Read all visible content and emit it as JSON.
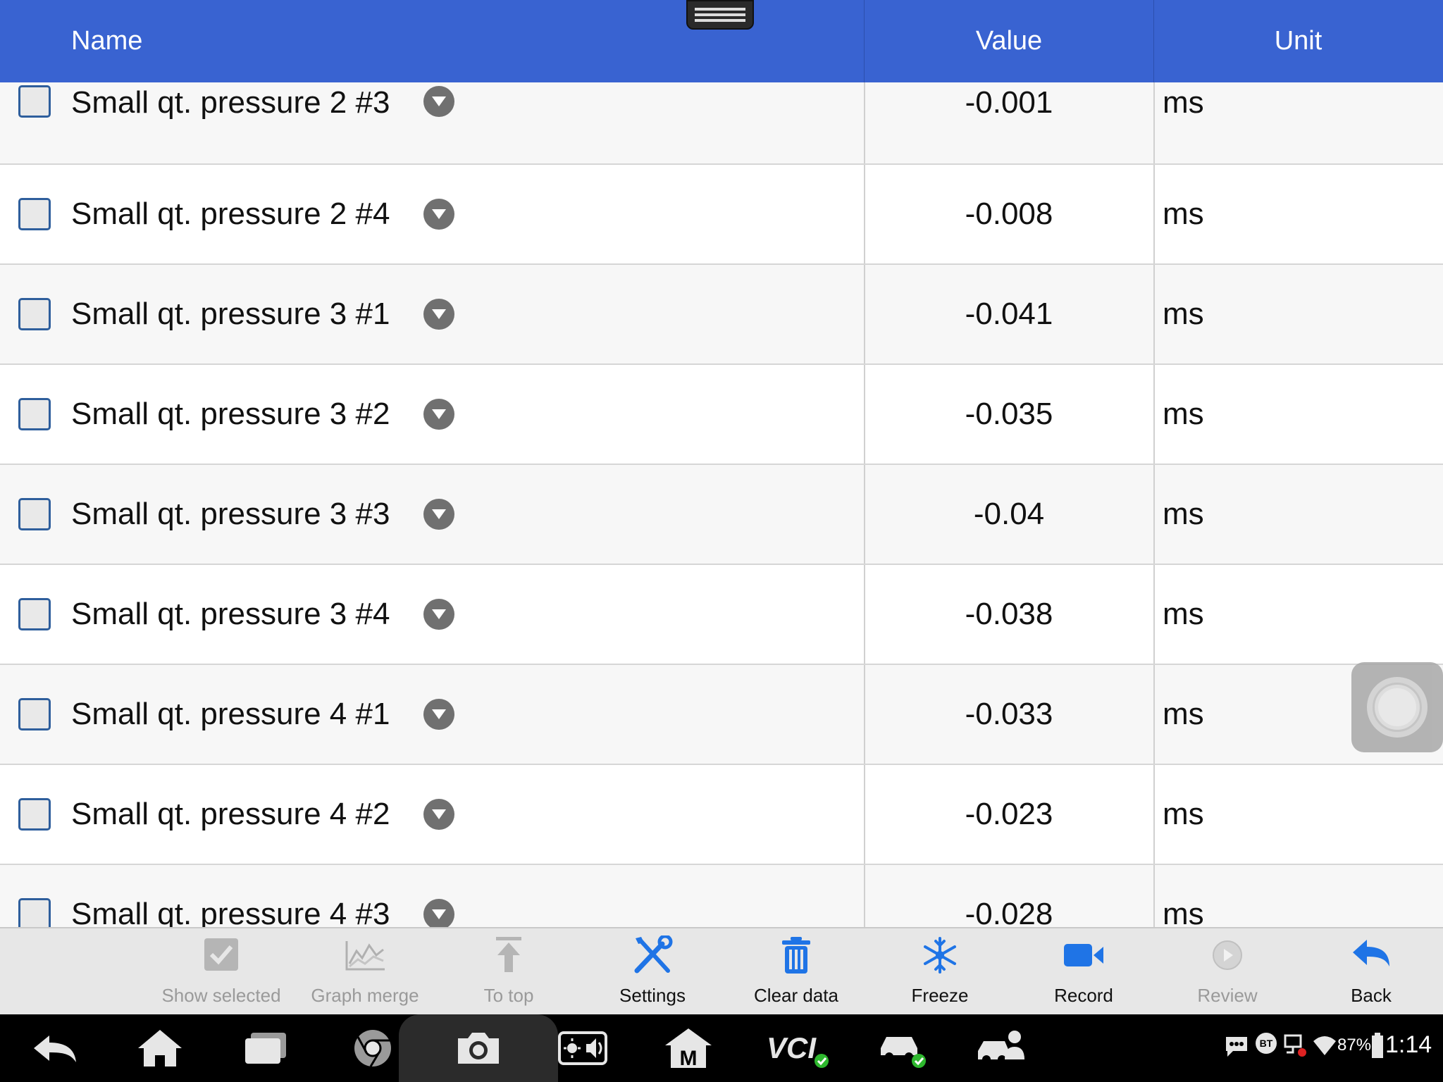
{
  "header": {
    "name": "Name",
    "value": "Value",
    "unit": "Unit"
  },
  "rows": [
    {
      "name": "Small qt. pressure 2 #3",
      "value": "-0.001",
      "unit": "ms"
    },
    {
      "name": "Small qt. pressure 2 #4",
      "value": "-0.008",
      "unit": "ms"
    },
    {
      "name": "Small qt. pressure 3 #1",
      "value": "-0.041",
      "unit": "ms"
    },
    {
      "name": "Small qt. pressure 3 #2",
      "value": "-0.035",
      "unit": "ms"
    },
    {
      "name": "Small qt. pressure 3 #3",
      "value": "-0.04",
      "unit": "ms"
    },
    {
      "name": "Small qt. pressure 3 #4",
      "value": "-0.038",
      "unit": "ms"
    },
    {
      "name": "Small qt. pressure 4 #1",
      "value": "-0.033",
      "unit": "ms"
    },
    {
      "name": "Small qt. pressure 4 #2",
      "value": "-0.023",
      "unit": "ms"
    },
    {
      "name": "Small qt. pressure 4 #3",
      "value": "-0.028",
      "unit": "ms"
    }
  ],
  "toolbar": {
    "show_selected": "Show selected",
    "graph_merge": "Graph merge",
    "to_top": "To top",
    "settings": "Settings",
    "clear_data": "Clear data",
    "freeze": "Freeze",
    "record": "Record",
    "review": "Review",
    "back": "Back"
  },
  "status": {
    "battery": "87%",
    "time": "1:14",
    "bt": "BT"
  },
  "colors": {
    "header": "#3963d1",
    "accent": "#1f74e6"
  }
}
